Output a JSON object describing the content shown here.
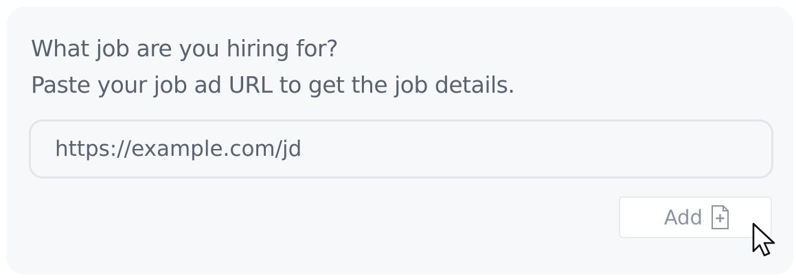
{
  "prompt": {
    "line1": "What job are you hiring for?",
    "line2": "Paste your job ad URL to get the job details."
  },
  "url_input": {
    "value": "https://example.com/jd",
    "placeholder": ""
  },
  "add_button": {
    "label": "Add",
    "icon": "file-plus-icon"
  },
  "pointer": {
    "icon": "mouse-cursor-icon"
  },
  "colors": {
    "card_background": "#f7f8fa",
    "text": "#59626e",
    "muted_text": "#8c95a1",
    "border": "#e2e5ea"
  }
}
